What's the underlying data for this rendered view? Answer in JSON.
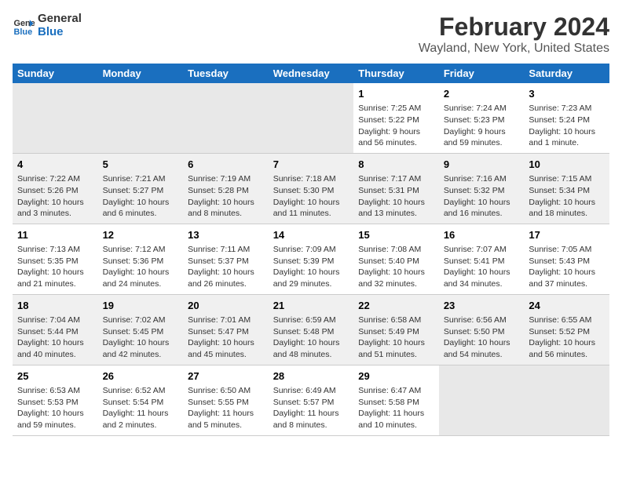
{
  "header": {
    "logo_line1": "General",
    "logo_line2": "Blue",
    "title": "February 2024",
    "subtitle": "Wayland, New York, United States"
  },
  "days_of_week": [
    "Sunday",
    "Monday",
    "Tuesday",
    "Wednesday",
    "Thursday",
    "Friday",
    "Saturday"
  ],
  "weeks": [
    {
      "id": "week1",
      "cells": [
        {
          "day": "",
          "num": "",
          "info": "",
          "empty": true
        },
        {
          "day": "",
          "num": "",
          "info": "",
          "empty": true
        },
        {
          "day": "",
          "num": "",
          "info": "",
          "empty": true
        },
        {
          "day": "",
          "num": "",
          "info": "",
          "empty": true
        },
        {
          "day": "Thursday",
          "num": "1",
          "info": "Sunrise: 7:25 AM\nSunset: 5:22 PM\nDaylight: 9 hours\nand 56 minutes.",
          "empty": false
        },
        {
          "day": "Friday",
          "num": "2",
          "info": "Sunrise: 7:24 AM\nSunset: 5:23 PM\nDaylight: 9 hours\nand 59 minutes.",
          "empty": false
        },
        {
          "day": "Saturday",
          "num": "3",
          "info": "Sunrise: 7:23 AM\nSunset: 5:24 PM\nDaylight: 10 hours\nand 1 minute.",
          "empty": false
        }
      ]
    },
    {
      "id": "week2",
      "cells": [
        {
          "day": "Sunday",
          "num": "4",
          "info": "Sunrise: 7:22 AM\nSunset: 5:26 PM\nDaylight: 10 hours\nand 3 minutes.",
          "empty": false
        },
        {
          "day": "Monday",
          "num": "5",
          "info": "Sunrise: 7:21 AM\nSunset: 5:27 PM\nDaylight: 10 hours\nand 6 minutes.",
          "empty": false
        },
        {
          "day": "Tuesday",
          "num": "6",
          "info": "Sunrise: 7:19 AM\nSunset: 5:28 PM\nDaylight: 10 hours\nand 8 minutes.",
          "empty": false
        },
        {
          "day": "Wednesday",
          "num": "7",
          "info": "Sunrise: 7:18 AM\nSunset: 5:30 PM\nDaylight: 10 hours\nand 11 minutes.",
          "empty": false
        },
        {
          "day": "Thursday",
          "num": "8",
          "info": "Sunrise: 7:17 AM\nSunset: 5:31 PM\nDaylight: 10 hours\nand 13 minutes.",
          "empty": false
        },
        {
          "day": "Friday",
          "num": "9",
          "info": "Sunrise: 7:16 AM\nSunset: 5:32 PM\nDaylight: 10 hours\nand 16 minutes.",
          "empty": false
        },
        {
          "day": "Saturday",
          "num": "10",
          "info": "Sunrise: 7:15 AM\nSunset: 5:34 PM\nDaylight: 10 hours\nand 18 minutes.",
          "empty": false
        }
      ]
    },
    {
      "id": "week3",
      "cells": [
        {
          "day": "Sunday",
          "num": "11",
          "info": "Sunrise: 7:13 AM\nSunset: 5:35 PM\nDaylight: 10 hours\nand 21 minutes.",
          "empty": false
        },
        {
          "day": "Monday",
          "num": "12",
          "info": "Sunrise: 7:12 AM\nSunset: 5:36 PM\nDaylight: 10 hours\nand 24 minutes.",
          "empty": false
        },
        {
          "day": "Tuesday",
          "num": "13",
          "info": "Sunrise: 7:11 AM\nSunset: 5:37 PM\nDaylight: 10 hours\nand 26 minutes.",
          "empty": false
        },
        {
          "day": "Wednesday",
          "num": "14",
          "info": "Sunrise: 7:09 AM\nSunset: 5:39 PM\nDaylight: 10 hours\nand 29 minutes.",
          "empty": false
        },
        {
          "day": "Thursday",
          "num": "15",
          "info": "Sunrise: 7:08 AM\nSunset: 5:40 PM\nDaylight: 10 hours\nand 32 minutes.",
          "empty": false
        },
        {
          "day": "Friday",
          "num": "16",
          "info": "Sunrise: 7:07 AM\nSunset: 5:41 PM\nDaylight: 10 hours\nand 34 minutes.",
          "empty": false
        },
        {
          "day": "Saturday",
          "num": "17",
          "info": "Sunrise: 7:05 AM\nSunset: 5:43 PM\nDaylight: 10 hours\nand 37 minutes.",
          "empty": false
        }
      ]
    },
    {
      "id": "week4",
      "cells": [
        {
          "day": "Sunday",
          "num": "18",
          "info": "Sunrise: 7:04 AM\nSunset: 5:44 PM\nDaylight: 10 hours\nand 40 minutes.",
          "empty": false
        },
        {
          "day": "Monday",
          "num": "19",
          "info": "Sunrise: 7:02 AM\nSunset: 5:45 PM\nDaylight: 10 hours\nand 42 minutes.",
          "empty": false
        },
        {
          "day": "Tuesday",
          "num": "20",
          "info": "Sunrise: 7:01 AM\nSunset: 5:47 PM\nDaylight: 10 hours\nand 45 minutes.",
          "empty": false
        },
        {
          "day": "Wednesday",
          "num": "21",
          "info": "Sunrise: 6:59 AM\nSunset: 5:48 PM\nDaylight: 10 hours\nand 48 minutes.",
          "empty": false
        },
        {
          "day": "Thursday",
          "num": "22",
          "info": "Sunrise: 6:58 AM\nSunset: 5:49 PM\nDaylight: 10 hours\nand 51 minutes.",
          "empty": false
        },
        {
          "day": "Friday",
          "num": "23",
          "info": "Sunrise: 6:56 AM\nSunset: 5:50 PM\nDaylight: 10 hours\nand 54 minutes.",
          "empty": false
        },
        {
          "day": "Saturday",
          "num": "24",
          "info": "Sunrise: 6:55 AM\nSunset: 5:52 PM\nDaylight: 10 hours\nand 56 minutes.",
          "empty": false
        }
      ]
    },
    {
      "id": "week5",
      "cells": [
        {
          "day": "Sunday",
          "num": "25",
          "info": "Sunrise: 6:53 AM\nSunset: 5:53 PM\nDaylight: 10 hours\nand 59 minutes.",
          "empty": false
        },
        {
          "day": "Monday",
          "num": "26",
          "info": "Sunrise: 6:52 AM\nSunset: 5:54 PM\nDaylight: 11 hours\nand 2 minutes.",
          "empty": false
        },
        {
          "day": "Tuesday",
          "num": "27",
          "info": "Sunrise: 6:50 AM\nSunset: 5:55 PM\nDaylight: 11 hours\nand 5 minutes.",
          "empty": false
        },
        {
          "day": "Wednesday",
          "num": "28",
          "info": "Sunrise: 6:49 AM\nSunset: 5:57 PM\nDaylight: 11 hours\nand 8 minutes.",
          "empty": false
        },
        {
          "day": "Thursday",
          "num": "29",
          "info": "Sunrise: 6:47 AM\nSunset: 5:58 PM\nDaylight: 11 hours\nand 10 minutes.",
          "empty": false
        },
        {
          "day": "",
          "num": "",
          "info": "",
          "empty": true
        },
        {
          "day": "",
          "num": "",
          "info": "",
          "empty": true
        }
      ]
    }
  ]
}
